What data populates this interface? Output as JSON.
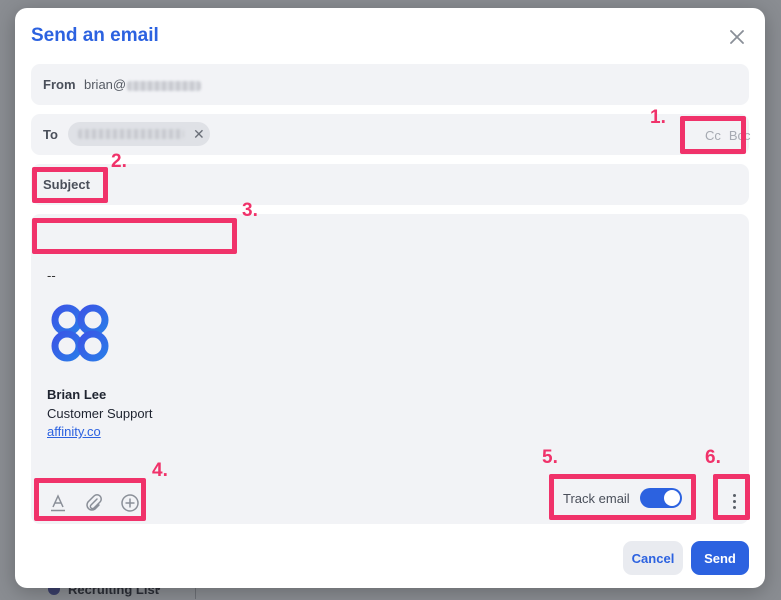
{
  "background": {
    "list_label": "Recruiting List",
    "dot": "•"
  },
  "modal": {
    "title": "Send an email",
    "close_icon": "close-icon"
  },
  "from": {
    "label": "From",
    "value_prefix": "brian@"
  },
  "to": {
    "label": "To",
    "chip_remove": "✕"
  },
  "cc_bcc": {
    "cc": "Cc",
    "bcc": "Bcc"
  },
  "subject": {
    "label": "Subject"
  },
  "signature": {
    "dash": "--",
    "name": "Brian Lee",
    "role": "Customer Support",
    "link": "affinity.co"
  },
  "toolbar": {
    "format_icon": "text-format-icon",
    "attach_icon": "paperclip-icon",
    "insert_icon": "plus-circle-icon"
  },
  "tracking": {
    "label": "Track email",
    "enabled": true
  },
  "more_icon": "kebab-menu-icon",
  "actions": {
    "cancel": "Cancel",
    "send": "Send"
  },
  "annotations": [
    "1.",
    "2.",
    "3.",
    "4.",
    "5.",
    "6."
  ],
  "colors": {
    "accent": "#2c62e0",
    "callout": "#f0326a",
    "field_bg": "#f2f3f6"
  }
}
